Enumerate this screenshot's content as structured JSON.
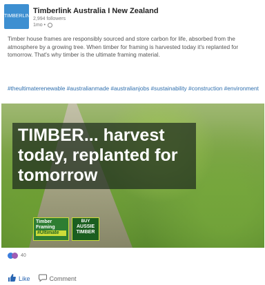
{
  "company": {
    "name": "Timberlink Australia I New Zealand",
    "followers": "2,994 followers",
    "time": "1mo •",
    "avatar_text": "TIMBERLINK"
  },
  "post": {
    "text": "Timber house frames are responsibly sourced and store carbon for life, absorbed from the atmosphere by a growing tree. When timber for framing is harvested today it's replanted for tomorrow. That's why timber is the ultimate framing material.",
    "hashtags": "#theultimaterenewable #australianmade #australianjobs #sustainability #construction #environment"
  },
  "image": {
    "headline": "TIMBER... harvest today, replanted for tomorrow",
    "logo_timber_framing": [
      "Timber",
      "Framing",
      "#Ultimate"
    ],
    "logo_aussie": [
      "BUY",
      "AUSSIE",
      "TIMBER"
    ]
  },
  "reactions": {
    "count": "40"
  },
  "actions": {
    "like": "Like",
    "comment": "Comment"
  },
  "colors": {
    "accent": "#2f6fae",
    "like": "#2b67b3"
  }
}
